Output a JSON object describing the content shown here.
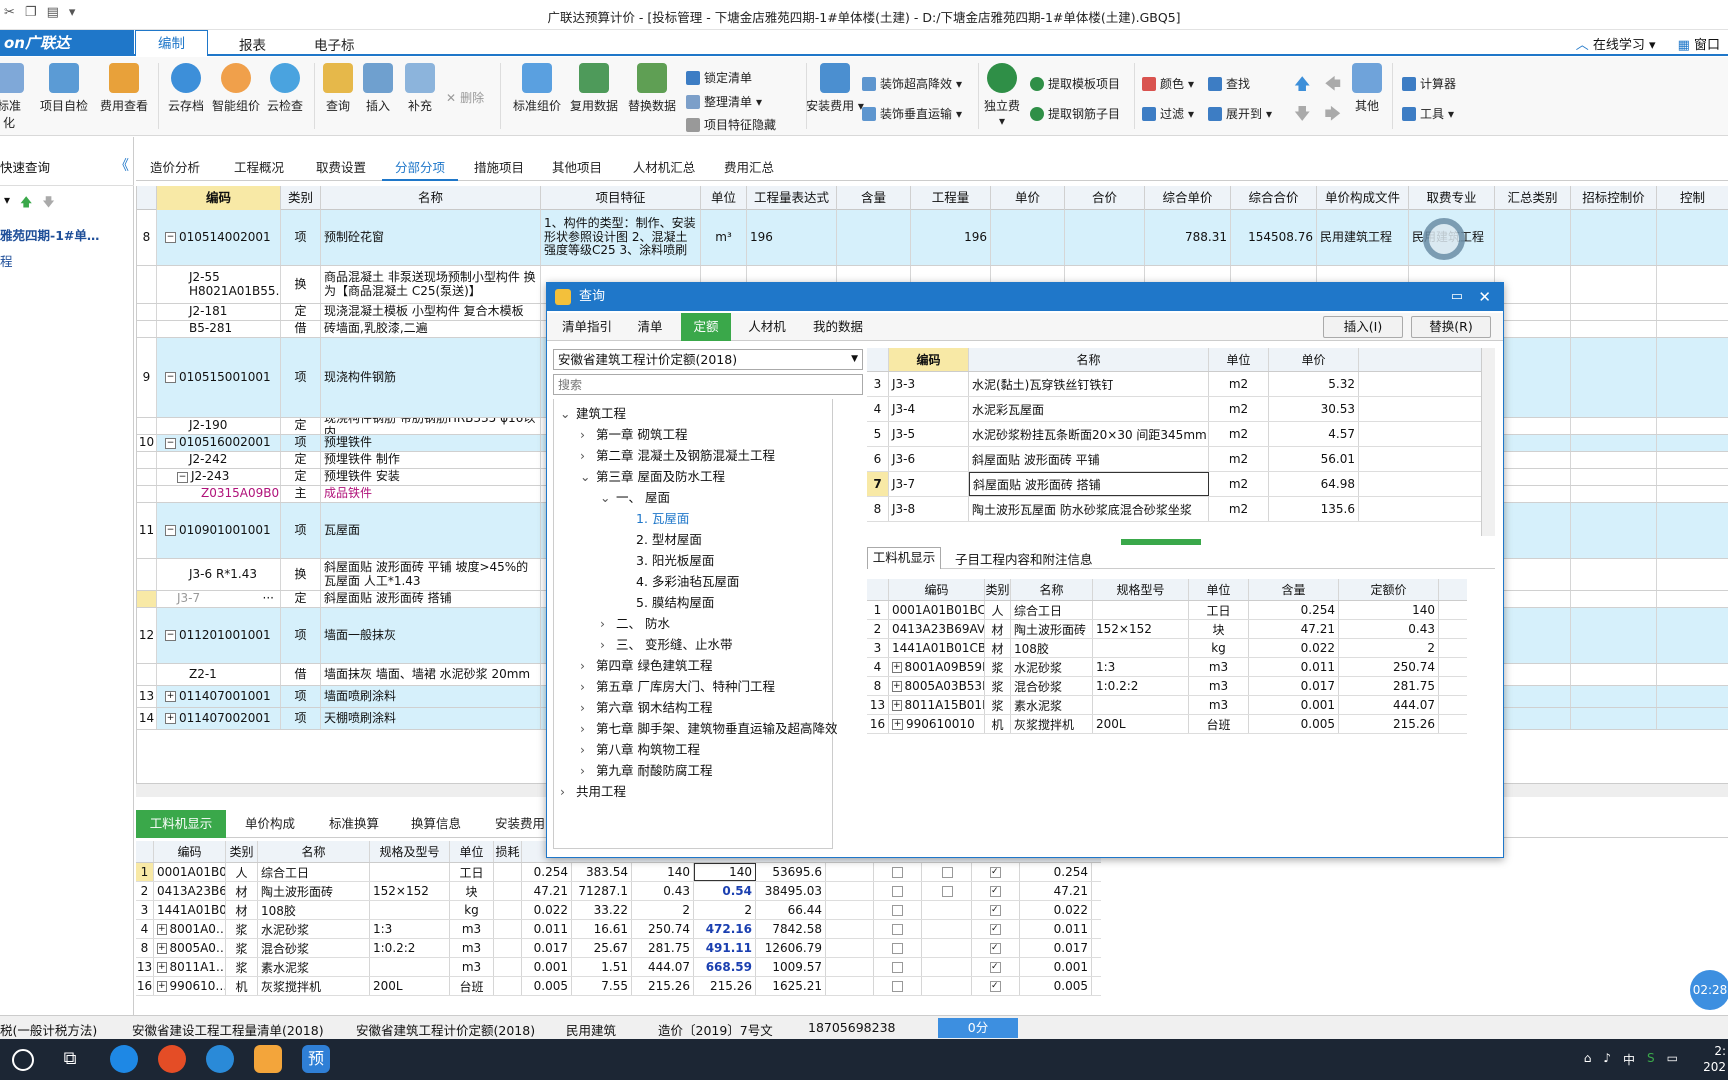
{
  "window": {
    "title": "广联达预算计价 - [投标管理 - 下塘金店雅苑四期-1#单体楼(土建) - D:/下塘金店雅苑四期-1#单体楼(土建).GBQ5]"
  },
  "menu": {
    "logo": "on广联达",
    "tabs": [
      "编制",
      "报表",
      "电子标"
    ],
    "active": "编制",
    "right": [
      "在线学习",
      "窗口"
    ]
  },
  "ribbon": {
    "big": [
      "标准化",
      "项目自检",
      "费用查看",
      "云存档",
      "智能组价",
      "云检查",
      "查询",
      "插入",
      "补充",
      "删除",
      "标准组价",
      "复用数据",
      "替换数据",
      "安装费用",
      "独立费",
      "其他"
    ],
    "small": [
      "锁定清单",
      "整理清单",
      "项目特征隐藏",
      "装饰超高降效",
      "装饰垂直运输",
      "提取模板项目",
      "提取钢筋子目",
      "颜色",
      "查找",
      "过滤",
      "展开到",
      "计算器",
      "工具"
    ]
  },
  "left": {
    "title": "快速查询",
    "node": "雅苑四期-1#单…",
    "sub": "程"
  },
  "pagetabs": [
    "造价分析",
    "工程概况",
    "取费设置",
    "分部分项",
    "措施项目",
    "其他项目",
    "人材机汇总",
    "费用汇总"
  ],
  "grid": {
    "headers": [
      "编码",
      "类别",
      "名称",
      "项目特征",
      "单位",
      "工程量表达式",
      "含量",
      "工程量",
      "单价",
      "合价",
      "综合单价",
      "综合合价",
      "单价构成文件",
      "取费专业",
      "汇总类别",
      "招标控制价",
      "控制"
    ],
    "rows": [
      {
        "no": "8",
        "code": "010514002001",
        "type": "项",
        "name": "预制砼花窗",
        "feat": "1、构件的类型：制作、安装 形状参照设计图 2、混凝土强度等级C25 3、涂料喷刷",
        "unit": "m³",
        "expr": "196",
        "qty": "196",
        "zhdj": "788.31",
        "zhhj": "154508.76",
        "file": "民用建筑工程",
        "zy": "民用建筑工程"
      },
      {
        "no": "",
        "code": "J2-55 H8021A01B55…",
        "type": "换",
        "name": "商品混凝土 非泵送现场预制小型构件 换为【商品混凝土 C25(泵送)】"
      },
      {
        "no": "",
        "code": "J2-181",
        "type": "定",
        "name": "现浇混凝土模板 小型构件 复合木模板"
      },
      {
        "no": "",
        "code": "B5-281",
        "type": "借",
        "name": "砖墙面,乳胶漆,二遍"
      },
      {
        "no": "9",
        "code": "010515001001",
        "type": "项",
        "name": "现浇构件钢筋"
      },
      {
        "no": "",
        "code": "J2-190",
        "type": "定",
        "name": "现浇构件钢筋 带肋钢筋HRB335 φ16以内"
      },
      {
        "no": "10",
        "code": "010516002001",
        "type": "项",
        "name": "预埋铁件"
      },
      {
        "no": "",
        "code": "J2-242",
        "type": "定",
        "name": "预埋铁件 制作"
      },
      {
        "no": "",
        "code": "J2-243",
        "type": "定",
        "name": "预埋铁件 安装"
      },
      {
        "no": "",
        "code": "Z0315A09B0…",
        "type": "主",
        "name": "成品铁件"
      },
      {
        "no": "11",
        "code": "010901001001",
        "type": "项",
        "name": "瓦屋面"
      },
      {
        "no": "",
        "code": "J3-6 R*1.43",
        "type": "换",
        "name": "斜屋面贴 波形面砖 平铺 坡度>45%的瓦屋面 人工*1.43"
      },
      {
        "no": "",
        "code": "J3-7",
        "type": "定",
        "name": "斜屋面贴 波形面砖 搭铺"
      },
      {
        "no": "12",
        "code": "011201001001",
        "type": "项",
        "name": "墙面一般抹灰"
      },
      {
        "no": "",
        "code": "Z2-1",
        "type": "借",
        "name": "墙面抹灰 墙面、墙裙 水泥砂浆 20mm"
      },
      {
        "no": "13",
        "code": "011407001001",
        "type": "项",
        "name": "墙面喷刷涂料"
      },
      {
        "no": "14",
        "code": "011407002001",
        "type": "项",
        "name": "天棚喷刷涂料"
      }
    ]
  },
  "bottom": {
    "tabs": [
      "工料机显示",
      "单价构成",
      "标准换算",
      "换算信息",
      "安装费用"
    ],
    "headers": [
      "编码",
      "类别",
      "名称",
      "规格及型号",
      "单位",
      "损耗"
    ],
    "rows": [
      {
        "no": "1",
        "code": "0001A01B0…",
        "type": "人",
        "name": "综合工日",
        "spec": "",
        "unit": "工日",
        "c1": "0.254",
        "c2": "383.54",
        "c3": "140",
        "c4": "140",
        "c5": "53695.6",
        "c6": "0.254"
      },
      {
        "no": "2",
        "code": "0413A23B6…",
        "type": "材",
        "name": "陶土波形面砖",
        "spec": "152×152",
        "unit": "块",
        "c1": "47.21",
        "c2": "71287.1",
        "c3": "0.43",
        "c4": "0.54",
        "c5": "38495.03",
        "c6": "47.21"
      },
      {
        "no": "3",
        "code": "1441A01B0…",
        "type": "材",
        "name": "108胶",
        "spec": "",
        "unit": "kg",
        "c1": "0.022",
        "c2": "33.22",
        "c3": "2",
        "c4": "2",
        "c5": "66.44",
        "c6": "0.022"
      },
      {
        "no": "4",
        "code": "8001A0…",
        "type": "浆",
        "name": "水泥砂浆",
        "spec": "1:3",
        "unit": "m3",
        "c1": "0.011",
        "c2": "16.61",
        "c3": "250.74",
        "c4": "472.16",
        "c5": "7842.58",
        "c6": "0.011"
      },
      {
        "no": "8",
        "code": "8005A0…",
        "type": "浆",
        "name": "混合砂浆",
        "spec": "1:0.2:2",
        "unit": "m3",
        "c1": "0.017",
        "c2": "25.67",
        "c3": "281.75",
        "c4": "491.11",
        "c5": "12606.79",
        "c6": "0.017"
      },
      {
        "no": "13",
        "code": "8011A1…",
        "type": "浆",
        "name": "素水泥浆",
        "spec": "",
        "unit": "m3",
        "c1": "0.001",
        "c2": "1.51",
        "c3": "444.07",
        "c4": "668.59",
        "c5": "1009.57",
        "c6": "0.001"
      },
      {
        "no": "16",
        "code": "990610…",
        "type": "机",
        "name": "灰浆搅拌机",
        "spec": "200L",
        "unit": "台班",
        "c1": "0.005",
        "c2": "7.55",
        "c3": "215.26",
        "c4": "215.26",
        "c5": "1625.21",
        "c6": "0.005"
      }
    ]
  },
  "dialog": {
    "title": "查询",
    "tabs": [
      "清单指引",
      "清单",
      "定额",
      "人材机",
      "我的数据"
    ],
    "active": "定额",
    "insert": "插入(I)",
    "replace": "替换(R)",
    "library": "安徽省建筑工程计价定额(2018)",
    "search_placeholder": "搜索",
    "tree": [
      {
        "t": "建筑工程",
        "lv": 0,
        "s": "v"
      },
      {
        "t": "第一章 砌筑工程",
        "lv": 1,
        "s": ">"
      },
      {
        "t": "第二章 混凝土及钢筋混凝土工程",
        "lv": 1,
        "s": ">"
      },
      {
        "t": "第三章 屋面及防水工程",
        "lv": 1,
        "s": "v"
      },
      {
        "t": "一、 屋面",
        "lv": 2,
        "s": "v"
      },
      {
        "t": "1. 瓦屋面",
        "lv": 3,
        "s": "",
        "sel": true
      },
      {
        "t": "2. 型材屋面",
        "lv": 3,
        "s": ""
      },
      {
        "t": "3. 阳光板屋面",
        "lv": 3,
        "s": ""
      },
      {
        "t": "4. 多彩油毡瓦屋面",
        "lv": 3,
        "s": ""
      },
      {
        "t": "5. 膜结构屋面",
        "lv": 3,
        "s": ""
      },
      {
        "t": "二、 防水",
        "lv": 2,
        "s": ">"
      },
      {
        "t": "三、 变形缝、止水带",
        "lv": 2,
        "s": ">"
      },
      {
        "t": "第四章 绿色建筑工程",
        "lv": 1,
        "s": ">"
      },
      {
        "t": "第五章 厂库房大门、特种门工程",
        "lv": 1,
        "s": ">"
      },
      {
        "t": "第六章 钢木结构工程",
        "lv": 1,
        "s": ">"
      },
      {
        "t": "第七章 脚手架、建筑物垂直运输及超高降效",
        "lv": 1,
        "s": ">"
      },
      {
        "t": "第八章 构筑物工程",
        "lv": 1,
        "s": ">"
      },
      {
        "t": "第九章 耐酸防腐工程",
        "lv": 1,
        "s": ">"
      },
      {
        "t": "共用工程",
        "lv": 0,
        "s": ">"
      }
    ],
    "qhead": [
      "编码",
      "名称",
      "单位",
      "单价"
    ],
    "qrows": [
      {
        "no": "3",
        "code": "J3-3",
        "name": "水泥(黏土)瓦穿铁丝钉铁钉",
        "unit": "m2",
        "price": "5.32"
      },
      {
        "no": "4",
        "code": "J3-4",
        "name": "水泥彩瓦屋面",
        "unit": "m2",
        "price": "30.53"
      },
      {
        "no": "5",
        "code": "J3-5",
        "name": "水泥砂浆粉挂瓦条断面20×30 间距345mm",
        "unit": "m2",
        "price": "4.57"
      },
      {
        "no": "6",
        "code": "J3-6",
        "name": "斜屋面贴 波形面砖 平铺",
        "unit": "m2",
        "price": "56.01"
      },
      {
        "no": "7",
        "code": "J3-7",
        "name": "斜屋面贴 波形面砖 搭铺",
        "unit": "m2",
        "price": "64.98"
      },
      {
        "no": "8",
        "code": "J3-8",
        "name": "陶土波形瓦屋面 防水砂浆底混合砂浆坐浆",
        "unit": "m2",
        "price": "135.6"
      }
    ],
    "subtabs": [
      "工料机显示",
      "子目工程内容和附注信息"
    ],
    "lhead": [
      "编码",
      "类别",
      "名称",
      "规格型号",
      "单位",
      "含量",
      "定额价"
    ],
    "lrows": [
      {
        "no": "1",
        "code": "0001A01B01BC",
        "type": "人",
        "name": "综合工日",
        "spec": "",
        "unit": "工日",
        "qty": "0.254",
        "price": "140"
      },
      {
        "no": "2",
        "code": "0413A23B69AV",
        "type": "材",
        "name": "陶土波形面砖",
        "spec": "152×152",
        "unit": "块",
        "qty": "47.21",
        "price": "0.43"
      },
      {
        "no": "3",
        "code": "1441A01B01CB",
        "type": "材",
        "name": "108胶",
        "spec": "",
        "unit": "kg",
        "qty": "0.022",
        "price": "2"
      },
      {
        "no": "4",
        "code": "8001A09B59BV",
        "type": "浆",
        "name": "水泥砂浆",
        "spec": "1:3",
        "unit": "m3",
        "qty": "0.011",
        "price": "250.74"
      },
      {
        "no": "8",
        "code": "8005A03B53BV",
        "type": "浆",
        "name": "混合砂浆",
        "spec": "1:0.2:2",
        "unit": "m3",
        "qty": "0.017",
        "price": "281.75"
      },
      {
        "no": "13",
        "code": "8011A15B01BV",
        "type": "浆",
        "name": "素水泥浆",
        "spec": "",
        "unit": "m3",
        "qty": "0.001",
        "price": "444.07"
      },
      {
        "no": "16",
        "code": "990610010",
        "type": "机",
        "name": "灰浆搅拌机",
        "spec": "200L",
        "unit": "台班",
        "qty": "0.005",
        "price": "215.26"
      }
    ]
  },
  "status": [
    "税(一般计税方法)",
    "安徽省建设工程工程量清单(2018)",
    "安徽省建筑工程计价定额(2018)",
    "民用建筑",
    "造价〔2019〕7号文",
    "18705698238",
    "0分"
  ],
  "timer": "02:28",
  "clock": [
    "2:",
    "202"
  ],
  "colors": {
    "accent": "#1f77c9",
    "green": "#3aa84a",
    "rowblue": "#d6f0fb"
  }
}
